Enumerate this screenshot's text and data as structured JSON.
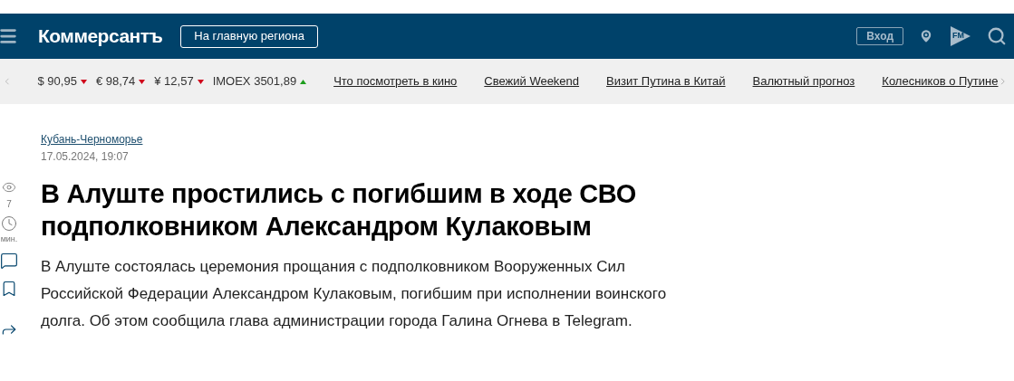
{
  "header": {
    "logo": "Коммерсантъ",
    "region_button": "На главную региона",
    "login_button": "Вход",
    "radio_label": "FM"
  },
  "ticker": {
    "rates": [
      {
        "label": "$ 90,95",
        "up": false
      },
      {
        "label": "€ 98,74",
        "up": false
      },
      {
        "label": "¥ 12,57",
        "up": false
      },
      {
        "label": "IMOEX 3501,89",
        "up": true
      }
    ],
    "links": [
      "Что посмотреть в кино",
      "Свежий Weekend",
      "Визит Путина в Китай",
      "Валютный прогноз",
      "Колесников о Путине"
    ]
  },
  "sidebar": {
    "views": "7",
    "read_time": "мин."
  },
  "article": {
    "rubric": "Кубань-Черноморье",
    "date": "17.05.2024, 19:07",
    "title": "В Алуште простились с погибшим в ходе СВО подполковником Александром Кулаковым",
    "lead": "В Алуште состоялась церемония прощания с подполковником Вооруженных Сил Российской Федерации Александром Кулаковым, погибшим при исполнении воинского долга. Об этом сообщила глава администрации города Галина Огнева в Telegram."
  }
}
